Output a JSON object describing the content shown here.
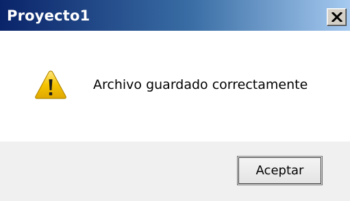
{
  "window": {
    "title": "Proyecto1",
    "close_icon": "close-icon"
  },
  "message": {
    "icon": "warning-icon",
    "text": "Archivo guardado correctamente"
  },
  "buttons": {
    "ok_label": "Aceptar"
  },
  "colors": {
    "titlebar_start": "#0a246a",
    "titlebar_end": "#a6caf0",
    "warning_fill": "#f5c400"
  }
}
